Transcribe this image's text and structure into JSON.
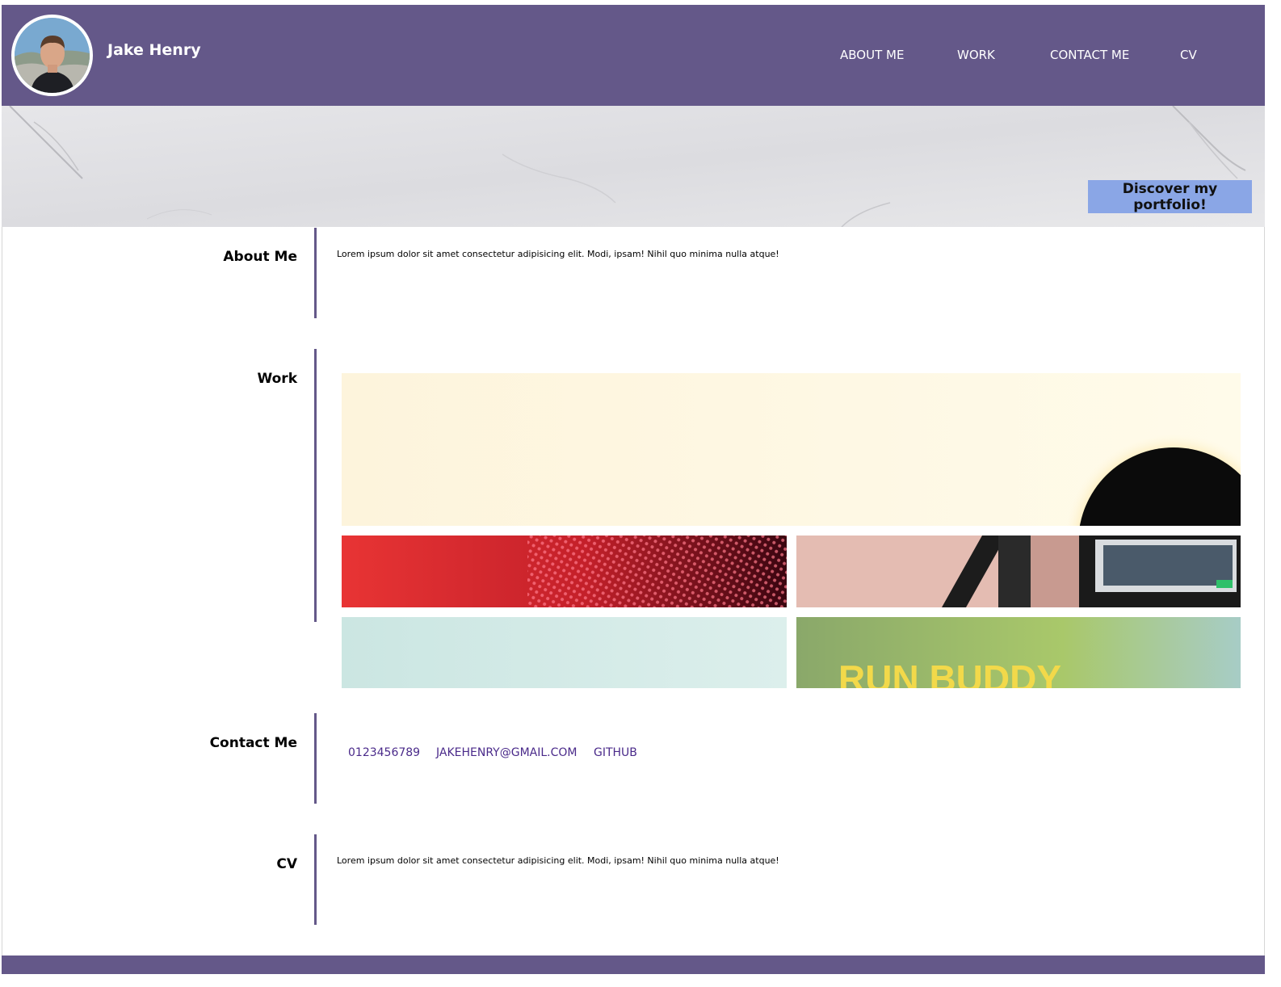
{
  "header": {
    "name": "Jake Henry",
    "nav": [
      {
        "label": "ABOUT ME"
      },
      {
        "label": "WORK"
      },
      {
        "label": "CONTACT ME"
      },
      {
        "label": "CV"
      }
    ]
  },
  "hero": {
    "button_label": "Discover my portfolio!"
  },
  "sections": {
    "about": {
      "title": "About Me",
      "text": "Lorem ipsum dolor sit amet consectetur adipisicing elit. Modi, ipsam! Nihil quo minima nulla atque!"
    },
    "work": {
      "title": "Work",
      "projects": [
        {
          "image": "sunny-sky-project"
        },
        {
          "image": "red-led-project"
        },
        {
          "image": "monitor-setup-project"
        },
        {
          "image": "mint-pastel-project"
        },
        {
          "image": "run-buddy-project",
          "caption": "RUN BUDDY"
        }
      ]
    },
    "contact": {
      "title": "Contact Me",
      "phone": "0123456789",
      "email": "JAKEHENRY@GMAIL.COM",
      "github": "GITHUB"
    },
    "cv": {
      "title": "CV",
      "text": "Lorem ipsum dolor sit amet consectetur adipisicing elit. Modi, ipsam! Nihil quo minima nulla atque!"
    }
  },
  "colors": {
    "brand": "#645889",
    "button": "#8aa6e6",
    "link": "#4a2a8a",
    "run_buddy_text": "#f2d94a"
  }
}
